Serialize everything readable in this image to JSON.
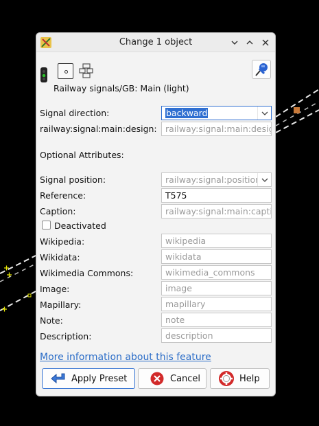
{
  "window": {
    "title": "Change 1 object"
  },
  "preset": {
    "name": "Railway signals/GB: Main (light)"
  },
  "fields": {
    "signal_direction": {
      "label": "Signal direction:",
      "value": "backward"
    },
    "main_design": {
      "label": "railway:signal:main:design:",
      "placeholder": "railway:signal:main:design"
    },
    "optional_heading": "Optional Attributes:",
    "signal_position": {
      "label": "Signal position:",
      "placeholder": "railway:signal:position"
    },
    "reference": {
      "label": "Reference:",
      "value": "T575"
    },
    "caption": {
      "label": "Caption:",
      "placeholder": "railway:signal:main:caption"
    },
    "deactivated": {
      "label": "Deactivated",
      "checked": false
    },
    "wikipedia": {
      "label": "Wikipedia:",
      "placeholder": "wikipedia"
    },
    "wikidata": {
      "label": "Wikidata:",
      "placeholder": "wikidata"
    },
    "wikimedia_commons": {
      "label": "Wikimedia Commons:",
      "placeholder": "wikimedia_commons"
    },
    "image": {
      "label": "Image:",
      "placeholder": "image"
    },
    "mapillary": {
      "label": "Mapillary:",
      "placeholder": "mapillary"
    },
    "note": {
      "label": "Note:",
      "placeholder": "note"
    },
    "description": {
      "label": "Description:",
      "placeholder": "description"
    }
  },
  "link": {
    "more_info": "More information about this feature"
  },
  "buttons": {
    "apply": "Apply Preset",
    "cancel": "Cancel",
    "help": "Help"
  },
  "icons": [
    "app-icon",
    "minimize-icon",
    "maximize-icon",
    "close-icon",
    "signal-light-icon",
    "point-node-icon",
    "multipolygon-icon",
    "pushpin-icon",
    "chevron-down-icon",
    "apply-arrow-icon",
    "cancel-icon",
    "help-lifebuoy-icon"
  ],
  "colors": {
    "accent": "#2f6fd1",
    "link": "#2a6cc7"
  }
}
